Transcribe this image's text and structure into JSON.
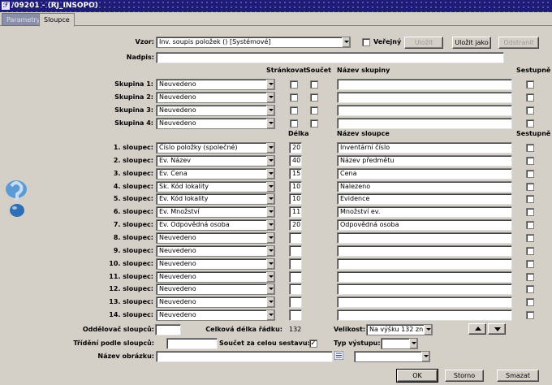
{
  "window": {
    "title": "/09201 - (RJ_INSOPO)"
  },
  "tabs": {
    "parametry": "Parametry",
    "sloupce": "Sloupce"
  },
  "top": {
    "vzor_label": "Vzor:",
    "vzor_value": "Inv. soupis položek  ()  [Systémové]",
    "verejny_label": "Veřejný",
    "ulozit": "Uložit",
    "ulozit_jako": "Uložit jako",
    "odstranit": "Odstranit",
    "nadpis_label": "Nadpis:",
    "nadpis_value": ""
  },
  "group_headers": {
    "strankovat": "Stránkovat",
    "soucet": "Součet",
    "nazev_skupiny": "Název skupiny",
    "sestupne": "Sestupně"
  },
  "groups": [
    {
      "label": "Skupina 1:",
      "value": "Neuvedeno",
      "name": ""
    },
    {
      "label": "Skupina 2:",
      "value": "Neuvedeno",
      "name": ""
    },
    {
      "label": "Skupina 3:",
      "value": "Neuvedeno",
      "name": ""
    },
    {
      "label": "Skupina 4:",
      "value": "Neuvedeno",
      "name": ""
    }
  ],
  "column_headers": {
    "delka": "Délka",
    "nazev_sloupce": "Název sloupce",
    "sestupne": "Sestupně"
  },
  "columns": [
    {
      "label": "1. sloupec:",
      "value": "Číslo položky (společné)",
      "length": "20",
      "name": "Inventární číslo"
    },
    {
      "label": "2. sloupec:",
      "value": "Ev. Název",
      "length": "40",
      "name": "Název předmětu"
    },
    {
      "label": "3. sloupec:",
      "value": "Ev. Cena",
      "length": "15",
      "name": "Cena"
    },
    {
      "label": "4. sloupec:",
      "value": "Sk. Kód lokality",
      "length": "10",
      "name": "Nalezeno"
    },
    {
      "label": "5. sloupec:",
      "value": "Ev. Kód lokality",
      "length": "10",
      "name": "Evidence"
    },
    {
      "label": "6. sloupec:",
      "value": "Ev. Množství",
      "length": "11",
      "name": "Množství ev."
    },
    {
      "label": "7. sloupec:",
      "value": "Ev. Odpovědná osoba",
      "length": "20",
      "name": "Odpovědná osoba"
    },
    {
      "label": "8. sloupec:",
      "value": "Neuvedeno",
      "length": "",
      "name": ""
    },
    {
      "label": "9. sloupec:",
      "value": "Neuvedeno",
      "length": "",
      "name": ""
    },
    {
      "label": "10. sloupec:",
      "value": "Neuvedeno",
      "length": "",
      "name": ""
    },
    {
      "label": "11. sloupec:",
      "value": "Neuvedeno",
      "length": "",
      "name": ""
    },
    {
      "label": "12. sloupec:",
      "value": "Neuvedeno",
      "length": "",
      "name": ""
    },
    {
      "label": "13. sloupec:",
      "value": "Neuvedeno",
      "length": "",
      "name": ""
    },
    {
      "label": "14. sloupec:",
      "value": "Neuvedeno",
      "length": "",
      "name": ""
    }
  ],
  "bottom": {
    "oddelovac_label": "Oddělovač sloupců:",
    "oddelovac_value": "",
    "celkova_label": "Celková délka řádku:",
    "celkova_value": "132",
    "velikost_label": "Velikost:",
    "velikost_value": "Na výšku 132 zn.",
    "trideni_label": "Třídění podle sloupců:",
    "trideni_value": "",
    "soucet_label": "Součet za celou sestavu:",
    "soucet_checked": "✓",
    "typ_label": "Typ výstupu:",
    "typ_value": "",
    "obrazek_label": "Název obrázku:",
    "obrazek_value": "",
    "obrazek_select": ""
  },
  "buttons": {
    "ok": "OK",
    "storno": "Storno",
    "smazat": "Smazat"
  },
  "icons": {
    "help": "help-icon",
    "list": "list-icon"
  }
}
